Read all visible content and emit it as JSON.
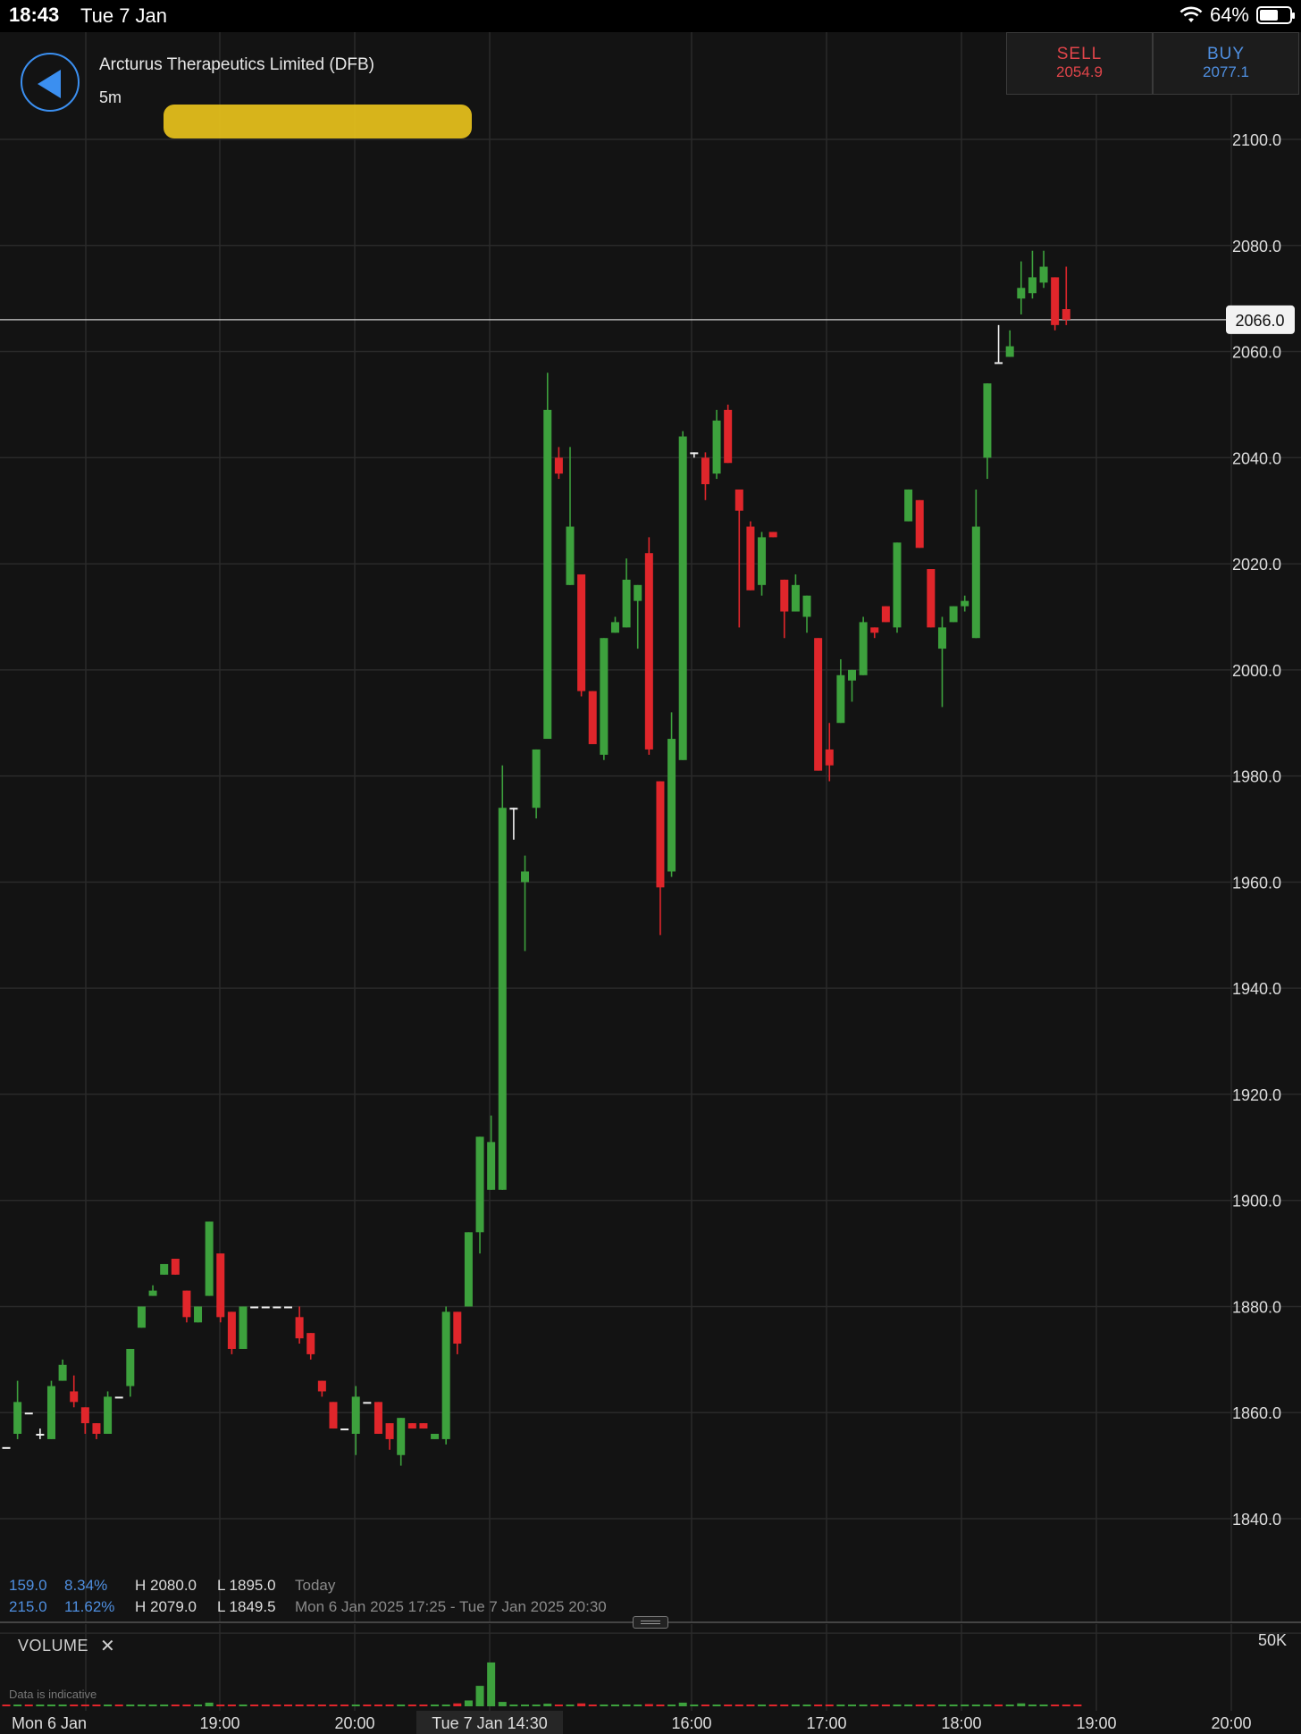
{
  "status_bar": {
    "time": "18:43",
    "date": "Tue 7 Jan",
    "battery": "64%",
    "battery_level": 0.64
  },
  "header": {
    "instrument": "Arcturus Therapeutics Limited (DFB)",
    "interval": "5m"
  },
  "trade": {
    "sell_label": "SELL",
    "sell_price": "2054.9",
    "buy_label": "BUY",
    "buy_price": "2077.1"
  },
  "colors": {
    "up": "#3da13d",
    "down": "#e0262b",
    "sell": "#e0454a",
    "buy": "#4f8fe0",
    "background": "#131313"
  },
  "stats": {
    "row1": {
      "change": "159.0",
      "pct": "8.34%",
      "high": "H 2080.0",
      "low": "L 1895.0",
      "period": "Today"
    },
    "row2": {
      "change": "215.0",
      "pct": "11.62%",
      "high": "H 2079.0",
      "low": "L 1849.5",
      "period": "Mon 6 Jan 2025 17:25 - Tue 7 Jan 2025 20:30"
    }
  },
  "volume": {
    "label": "VOLUME",
    "close": "✕",
    "axis_label": "50K"
  },
  "disclaimer": "Data is indicative",
  "chart_data": {
    "type": "candlestick",
    "ylim": [
      1826,
      2114
    ],
    "yticks": [
      "2100.0",
      "2080.0",
      "2060.0",
      "2040.0",
      "2020.0",
      "2000.0",
      "1980.0",
      "1960.0",
      "1940.0",
      "1920.0",
      "1900.0",
      "1880.0",
      "1860.0",
      "1840.0"
    ],
    "current_price": "2066.0",
    "xticks": [
      "Mon 6 Jan",
      "19:00",
      "20:00",
      "Tue 7 Jan 14:30",
      "16:00",
      "17:00",
      "18:00",
      "19:00",
      "20:00"
    ],
    "candles": [
      {
        "o": 1853.5,
        "h": 1853.5,
        "l": 1853.5,
        "c": 1853.5
      },
      {
        "o": 1856,
        "h": 1866,
        "l": 1855,
        "c": 1862
      },
      {
        "o": 1860,
        "h": 1860,
        "l": 1860,
        "c": 1860
      },
      {
        "o": 1856,
        "h": 1857,
        "l": 1855,
        "c": 1856
      },
      {
        "o": 1855,
        "h": 1866,
        "l": 1855,
        "c": 1865
      },
      {
        "o": 1866,
        "h": 1870,
        "l": 1866,
        "c": 1869
      },
      {
        "o": 1864,
        "h": 1867,
        "l": 1861,
        "c": 1862
      },
      {
        "o": 1861,
        "h": 1861,
        "l": 1856,
        "c": 1858
      },
      {
        "o": 1858,
        "h": 1858,
        "l": 1855,
        "c": 1856
      },
      {
        "o": 1856,
        "h": 1864,
        "l": 1856,
        "c": 1863
      },
      {
        "o": 1863,
        "h": 1863,
        "l": 1863,
        "c": 1863
      },
      {
        "o": 1865,
        "h": 1872,
        "l": 1863,
        "c": 1872
      },
      {
        "o": 1876,
        "h": 1880,
        "l": 1876,
        "c": 1880
      },
      {
        "o": 1882,
        "h": 1884,
        "l": 1882,
        "c": 1883
      },
      {
        "o": 1886,
        "h": 1888,
        "l": 1886,
        "c": 1888
      },
      {
        "o": 1889,
        "h": 1889,
        "l": 1886,
        "c": 1886
      },
      {
        "o": 1883,
        "h": 1883,
        "l": 1877,
        "c": 1878
      },
      {
        "o": 1877,
        "h": 1880,
        "l": 1877,
        "c": 1880
      },
      {
        "o": 1882,
        "h": 1896,
        "l": 1882,
        "c": 1896
      },
      {
        "o": 1890,
        "h": 1890,
        "l": 1877,
        "c": 1878
      },
      {
        "o": 1879,
        "h": 1879,
        "l": 1871,
        "c": 1872
      },
      {
        "o": 1872,
        "h": 1880,
        "l": 1872,
        "c": 1880
      },
      {
        "o": 1880,
        "h": 1880,
        "l": 1880,
        "c": 1880
      },
      {
        "o": 1880,
        "h": 1880,
        "l": 1880,
        "c": 1880
      },
      {
        "o": 1880,
        "h": 1880,
        "l": 1880,
        "c": 1880
      },
      {
        "o": 1880,
        "h": 1880,
        "l": 1880,
        "c": 1880
      },
      {
        "o": 1878,
        "h": 1880,
        "l": 1873,
        "c": 1874
      },
      {
        "o": 1875,
        "h": 1875,
        "l": 1870,
        "c": 1871
      },
      {
        "o": 1866,
        "h": 1866,
        "l": 1863,
        "c": 1864
      },
      {
        "o": 1862,
        "h": 1862,
        "l": 1857,
        "c": 1857
      },
      {
        "o": 1857,
        "h": 1857,
        "l": 1857,
        "c": 1857
      },
      {
        "o": 1856,
        "h": 1865,
        "l": 1852,
        "c": 1863
      },
      {
        "o": 1862,
        "h": 1862,
        "l": 1862,
        "c": 1862
      },
      {
        "o": 1862,
        "h": 1862,
        "l": 1856,
        "c": 1856
      },
      {
        "o": 1858,
        "h": 1858,
        "l": 1853,
        "c": 1855
      },
      {
        "o": 1852,
        "h": 1859,
        "l": 1850,
        "c": 1859
      },
      {
        "o": 1858,
        "h": 1858,
        "l": 1857,
        "c": 1857
      },
      {
        "o": 1858,
        "h": 1858,
        "l": 1857,
        "c": 1857
      },
      {
        "o": 1855,
        "h": 1856,
        "l": 1855,
        "c": 1856
      },
      {
        "o": 1855,
        "h": 1880,
        "l": 1854,
        "c": 1879
      },
      {
        "o": 1879,
        "h": 1879,
        "l": 1871,
        "c": 1873
      },
      {
        "o": 1880,
        "h": 1894,
        "l": 1880,
        "c": 1894
      },
      {
        "o": 1894,
        "h": 1912,
        "l": 1890,
        "c": 1912
      },
      {
        "o": 1902,
        "h": 1916,
        "l": 1902,
        "c": 1911
      },
      {
        "o": 1902,
        "h": 1982,
        "l": 1902,
        "c": 1974
      },
      {
        "o": 1974,
        "h": 1974,
        "l": 1968,
        "c": 1974
      },
      {
        "o": 1960,
        "h": 1965,
        "l": 1947,
        "c": 1962
      },
      {
        "o": 1974,
        "h": 1985,
        "l": 1972,
        "c": 1985
      },
      {
        "o": 1987,
        "h": 2056,
        "l": 1987,
        "c": 2049
      },
      {
        "o": 2040,
        "h": 2042,
        "l": 2036,
        "c": 2037
      },
      {
        "o": 2016,
        "h": 2042,
        "l": 2016,
        "c": 2027
      },
      {
        "o": 2018,
        "h": 2018,
        "l": 1995,
        "c": 1996
      },
      {
        "o": 1996,
        "h": 1996,
        "l": 1986,
        "c": 1986
      },
      {
        "o": 1984,
        "h": 2006,
        "l": 1983,
        "c": 2006
      },
      {
        "o": 2007,
        "h": 2010,
        "l": 2007,
        "c": 2009
      },
      {
        "o": 2008,
        "h": 2021,
        "l": 2008,
        "c": 2017
      },
      {
        "o": 2013,
        "h": 2016,
        "l": 2004,
        "c": 2016
      },
      {
        "o": 2022,
        "h": 2025,
        "l": 1984,
        "c": 1985
      },
      {
        "o": 1979,
        "h": 1979,
        "l": 1950,
        "c": 1959
      },
      {
        "o": 1962,
        "h": 1992,
        "l": 1961,
        "c": 1987
      },
      {
        "o": 1983,
        "h": 2045,
        "l": 1983,
        "c": 2044
      },
      {
        "o": 2041,
        "h": 2041,
        "l": 2040,
        "c": 2041
      },
      {
        "o": 2040,
        "h": 2041,
        "l": 2032,
        "c": 2035
      },
      {
        "o": 2037,
        "h": 2049,
        "l": 2036,
        "c": 2047
      },
      {
        "o": 2049,
        "h": 2050,
        "l": 2039,
        "c": 2039
      },
      {
        "o": 2034,
        "h": 2034,
        "l": 2008,
        "c": 2030
      },
      {
        "o": 2027,
        "h": 2028,
        "l": 2015,
        "c": 2015
      },
      {
        "o": 2016,
        "h": 2026,
        "l": 2014,
        "c": 2025
      },
      {
        "o": 2026,
        "h": 2026,
        "l": 2025,
        "c": 2025
      },
      {
        "o": 2017,
        "h": 2017,
        "l": 2006,
        "c": 2011
      },
      {
        "o": 2011,
        "h": 2018,
        "l": 2011,
        "c": 2016
      },
      {
        "o": 2010,
        "h": 2014,
        "l": 2007,
        "c": 2014
      },
      {
        "o": 2006,
        "h": 2006,
        "l": 1981,
        "c": 1981
      },
      {
        "o": 1985,
        "h": 1990,
        "l": 1979,
        "c": 1982
      },
      {
        "o": 1990,
        "h": 2002,
        "l": 1990,
        "c": 1999
      },
      {
        "o": 1998,
        "h": 2000,
        "l": 1994,
        "c": 2000
      },
      {
        "o": 1999,
        "h": 2010,
        "l": 1999,
        "c": 2009
      },
      {
        "o": 2008,
        "h": 2008,
        "l": 2006,
        "c": 2007
      },
      {
        "o": 2012,
        "h": 2012,
        "l": 2009,
        "c": 2009
      },
      {
        "o": 2008,
        "h": 2024,
        "l": 2007,
        "c": 2024
      },
      {
        "o": 2028,
        "h": 2034,
        "l": 2028,
        "c": 2034
      },
      {
        "o": 2032,
        "h": 2032,
        "l": 2023,
        "c": 2023
      },
      {
        "o": 2019,
        "h": 2019,
        "l": 2008,
        "c": 2008
      },
      {
        "o": 2004,
        "h": 2010,
        "l": 1993,
        "c": 2008
      },
      {
        "o": 2009,
        "h": 2012,
        "l": 2009,
        "c": 2012
      },
      {
        "o": 2012,
        "h": 2014,
        "l": 2011,
        "c": 2013
      },
      {
        "o": 2006,
        "h": 2034,
        "l": 2006,
        "c": 2027
      },
      {
        "o": 2040,
        "h": 2054,
        "l": 2036,
        "c": 2054
      },
      {
        "o": 2058,
        "h": 2065,
        "l": 2058,
        "c": 2058
      },
      {
        "o": 2059,
        "h": 2064,
        "l": 2059,
        "c": 2061
      },
      {
        "o": 2070,
        "h": 2077,
        "l": 2067,
        "c": 2072
      },
      {
        "o": 2071,
        "h": 2079,
        "l": 2070,
        "c": 2074
      },
      {
        "o": 2073,
        "h": 2079,
        "l": 2072,
        "c": 2076
      },
      {
        "o": 2074,
        "h": 2074,
        "l": 2064,
        "c": 2065
      },
      {
        "o": 2068,
        "h": 2076,
        "l": 2065,
        "c": 2066
      }
    ],
    "volume_ylim": [
      0,
      55000
    ],
    "volume": [
      0,
      0,
      0,
      0,
      0,
      500,
      0,
      0,
      0,
      0,
      0,
      0,
      0,
      0,
      0,
      0,
      0,
      0,
      2500,
      0,
      0,
      0,
      0,
      0,
      0,
      0,
      0,
      0,
      0,
      0,
      0,
      0,
      0,
      0,
      0,
      0,
      0,
      0,
      0,
      500,
      2000,
      4000,
      14000,
      30000,
      3000,
      1000,
      0,
      800,
      1800,
      500,
      1200,
      2000,
      900,
      700,
      500,
      700,
      500,
      1500,
      700,
      1000,
      2500,
      500,
      700,
      800,
      500,
      400,
      300,
      600,
      300,
      400,
      500,
      300,
      300,
      400,
      500,
      400,
      600,
      500,
      400,
      700,
      500,
      600,
      400,
      300,
      400,
      500,
      600,
      1000,
      900,
      500,
      2000,
      600,
      500,
      800,
      400,
      1200
    ],
    "volume_up": [
      false,
      true,
      false,
      true,
      true,
      true,
      false,
      false,
      false,
      true,
      false,
      true,
      true,
      true,
      true,
      false,
      false,
      true,
      true,
      false,
      false,
      true,
      false,
      false,
      false,
      false,
      false,
      false,
      false,
      false,
      false,
      true,
      false,
      false,
      false,
      true,
      false,
      false,
      true,
      true,
      false,
      true,
      true,
      true,
      true,
      true,
      true,
      true,
      true,
      false,
      true,
      false,
      false,
      true,
      true,
      true,
      true,
      false,
      false,
      true,
      true,
      true,
      false,
      true,
      false,
      false,
      false,
      true,
      false,
      false,
      true,
      true,
      false,
      false,
      true,
      true,
      true,
      false,
      false,
      true,
      true,
      false,
      false,
      true,
      true,
      true,
      true,
      true,
      false,
      true,
      true,
      true,
      true,
      false,
      false
    ]
  }
}
